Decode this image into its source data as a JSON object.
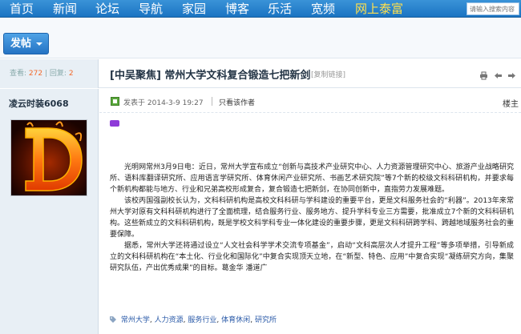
{
  "nav": {
    "items": [
      "首页",
      "新闻",
      "论坛",
      "导航",
      "家园",
      "博客",
      "乐活",
      "宽频"
    ],
    "special": "网上泰富",
    "search_placeholder": "请输入搜索内容"
  },
  "post_button": "发帖",
  "stats": {
    "views_label": "查看:",
    "views": "272",
    "divider": "|",
    "replies_label": "回复:",
    "replies": "2"
  },
  "thread": {
    "title": "[中吴聚焦] 常州大学文科复合锻造七把新剑",
    "copy_link": "[复制链接]"
  },
  "author": {
    "name": "凌云时装6068"
  },
  "post": {
    "posted_prefix": "发表于",
    "posted_time": "2014-3-9 19:27",
    "only_author": "只看该作者",
    "floor": "楼主",
    "paragraphs": [
      "光明网常州3月9日电：近日，常州大学宣布成立“创新与高技术产业研究中心、人力资源管理研究中心、旅游产业战略研究所、语料库翻译研究所、应用语言学研究所、体育休闲产业研究所、书画艺术研究院”等7个新的校级文科科研机构，并要求每个新机构都能与地方、行业和兄弟高校形成复合，复合锻造七把新剑，在协同创新中，直指劳力发展难题。",
      "该校丙国强副校长认为，文科科研机构是高校文科科研与学科建设的重要平台，更是文科服务社会的“利器”。2013年来常州大学对原有文科科研机构进行了全面梳理，结合服务行业、服务地方、提升学科专业三方需要，批准成立7个新的文科科研机构。这些新成立的文科科研机构，既是学校文科学科专业一体化建设的重要步骤，更是文科科研跨学科、跨越地域服务社会的重要保障。",
      "据悉，常州大学还将通过设立“人文社会科学学术交流专项基金”，启动“文科高层次人才提升工程”等多项举措，引导新成立的文科科研机构在“本土化、行业化和国际化”中复合实现顶天立地，在“新型、特色、应用”中复合实现“凝练研究方向，集聚研究队伍，产出优秀成果”的目标。葛金华 潘道广"
    ]
  },
  "tags": [
    "常州大学",
    "人力资源",
    "服务行业",
    "体育休闲",
    "研究所"
  ],
  "colors": {
    "nav_bg": "#1b74c2",
    "special": "#ffe04d",
    "accent_number": "#f26a2c",
    "tag_link": "#2a5aa8"
  },
  "icons": [
    "print-icon",
    "prev-thread-icon",
    "next-thread-icon",
    "poster-icon",
    "tag-icon"
  ]
}
